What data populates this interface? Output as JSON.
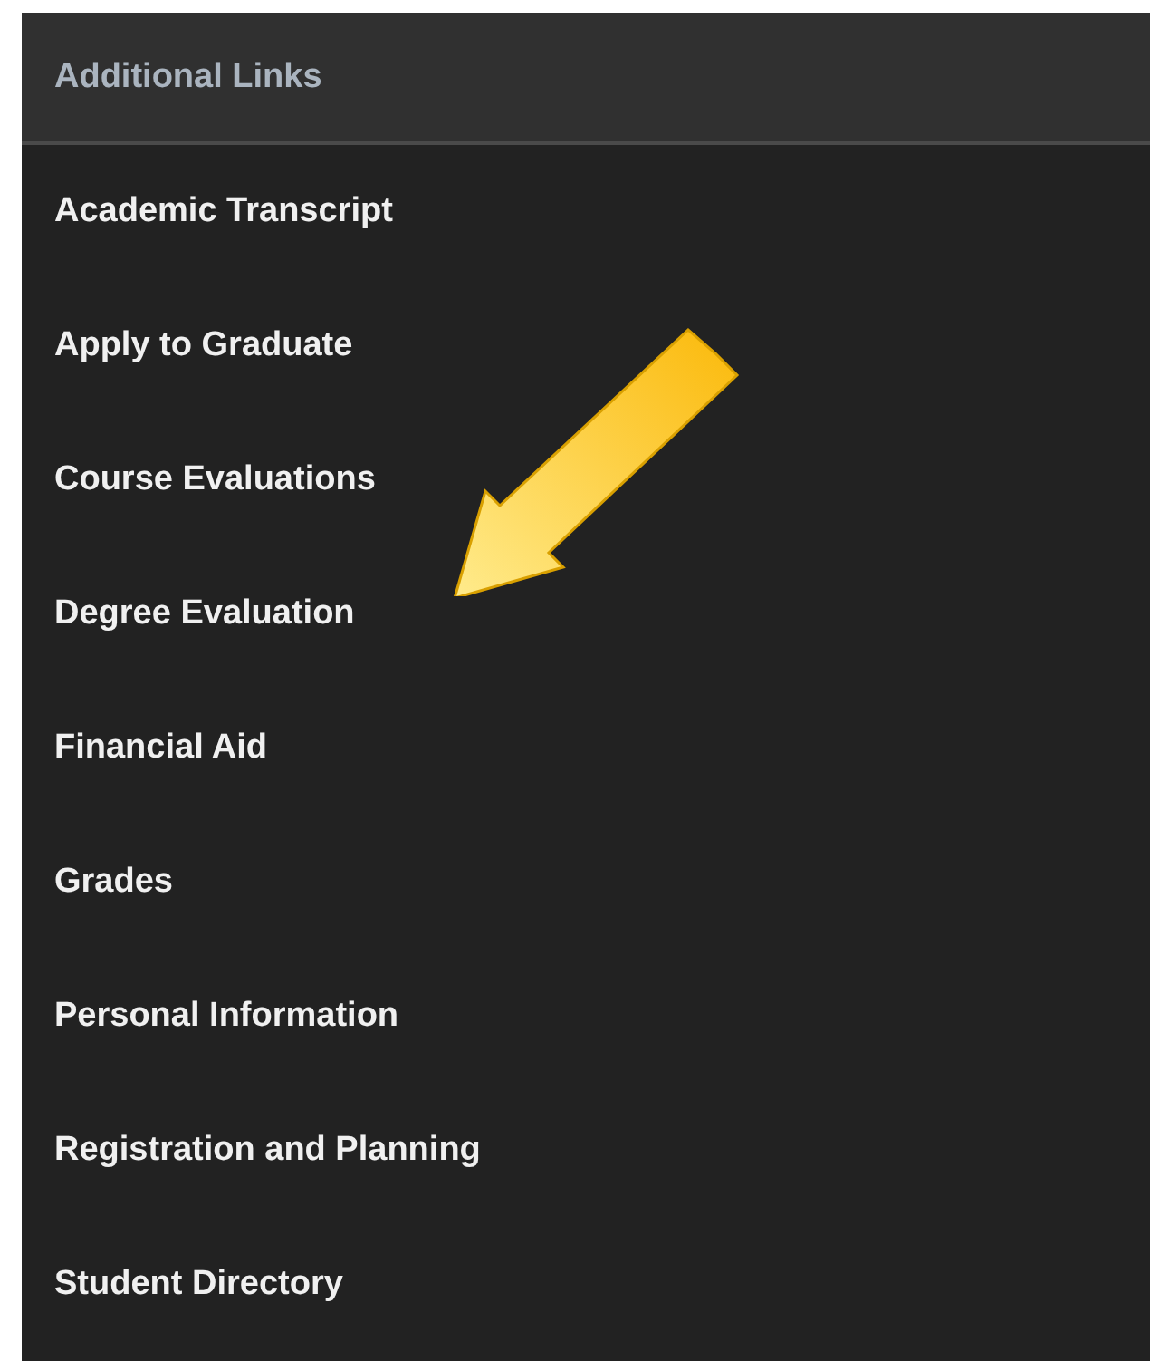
{
  "panel": {
    "title": "Additional Links",
    "links": [
      {
        "label": "Academic Transcript"
      },
      {
        "label": "Apply to Graduate"
      },
      {
        "label": "Course Evaluations"
      },
      {
        "label": "Degree Evaluation"
      },
      {
        "label": "Financial Aid"
      },
      {
        "label": "Grades"
      },
      {
        "label": "Personal Information"
      },
      {
        "label": "Registration and Planning"
      },
      {
        "label": "Student Directory"
      }
    ]
  }
}
